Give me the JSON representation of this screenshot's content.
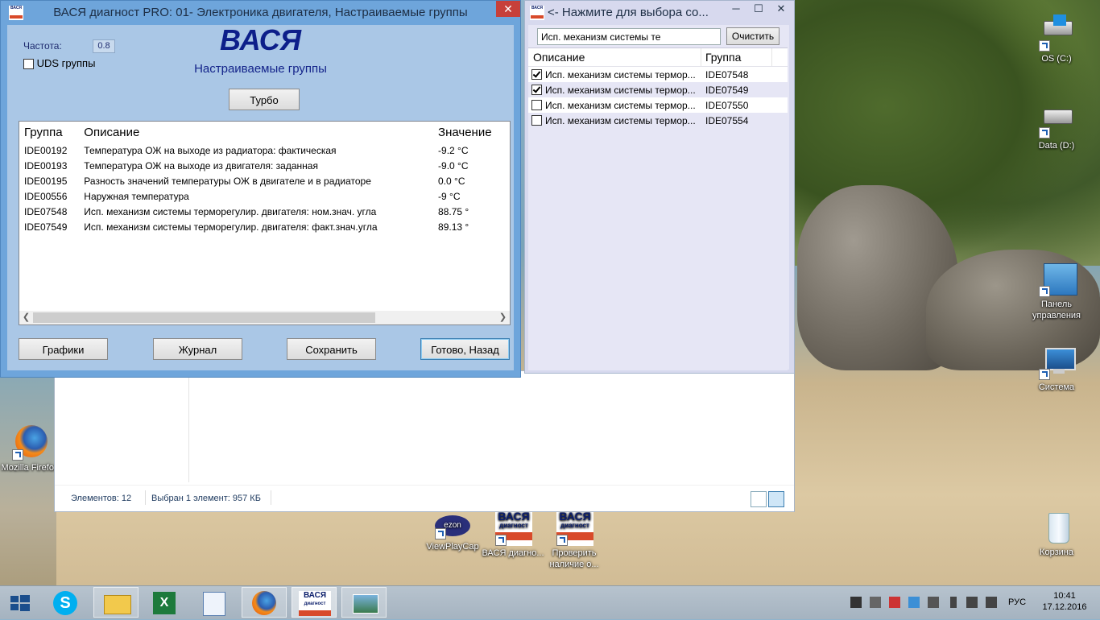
{
  "main_window": {
    "title": "ВАСЯ диагност PRO: 01- Электроника двигателя,  Настраиваемые группы",
    "close": "✕",
    "frequency_label": "Частота:",
    "frequency_value": "0.8",
    "uds_label": "UDS группы",
    "logo_text": "ВАСЯ",
    "subtitle": "Настраиваемые группы",
    "turbo_button": "Турбо",
    "table": {
      "headers": [
        "Группа",
        "Описание",
        "Значение"
      ],
      "rows": [
        [
          "IDE00192",
          "Температура ОЖ на выходе из радиатора: фактическая",
          "-9.2 °C"
        ],
        [
          "IDE00193",
          "Температура ОЖ на выходе из двигателя: заданная",
          "-9.0 °C"
        ],
        [
          "IDE00195",
          "Разность значений температуры ОЖ в двигателе и в радиаторе",
          "0.0 °C"
        ],
        [
          "IDE00556",
          "Наружная температура",
          "-9 °C"
        ],
        [
          "IDE07548",
          "Исп. механизм системы терморегулир. двигателя: ном.знач. угла",
          "88.75 °"
        ],
        [
          "IDE07549",
          "Исп. механизм системы терморегулир. двигателя: факт.знач.угла",
          "89.13 °"
        ]
      ]
    },
    "buttons": {
      "graphs": "Графики",
      "journal": "Журнал",
      "save": "Сохранить",
      "done": "Готово, Назад"
    }
  },
  "select_window": {
    "title": "<- Нажмите для выбора со...",
    "minimize": "─",
    "maximize": "☐",
    "close": "✕",
    "search_value": "Исп. механизм системы те",
    "clear_button": "Очистить",
    "headers": [
      "Описание",
      "Группа"
    ],
    "rows": [
      {
        "desc": "Исп. механизм системы термор...",
        "group": "IDE07548",
        "checked": true
      },
      {
        "desc": "Исп. механизм системы термор...",
        "group": "IDE07549",
        "checked": true
      },
      {
        "desc": "Исп. механизм системы термор...",
        "group": "IDE07550",
        "checked": false
      },
      {
        "desc": "Исп. механизм системы термор...",
        "group": "IDE07554",
        "checked": false
      }
    ]
  },
  "explorer": {
    "items_count": "Элементов: 12",
    "selected": "Выбран 1 элемент: 957 КБ"
  },
  "desktop_icons": {
    "os": "OS (C:)",
    "data": "Data (D:)",
    "control_panel": "Панель управления",
    "system": "Система",
    "trash": "Корзина",
    "firefox": "Mozilla Firefox",
    "viewplaycap": "ViewPlayCap",
    "vasya_diag": "ВАСЯ диагно...",
    "check_update": "Проверить наличие о..."
  },
  "taskbar": {
    "language": "РУС",
    "time": "10:41",
    "date": "17.12.2016"
  }
}
